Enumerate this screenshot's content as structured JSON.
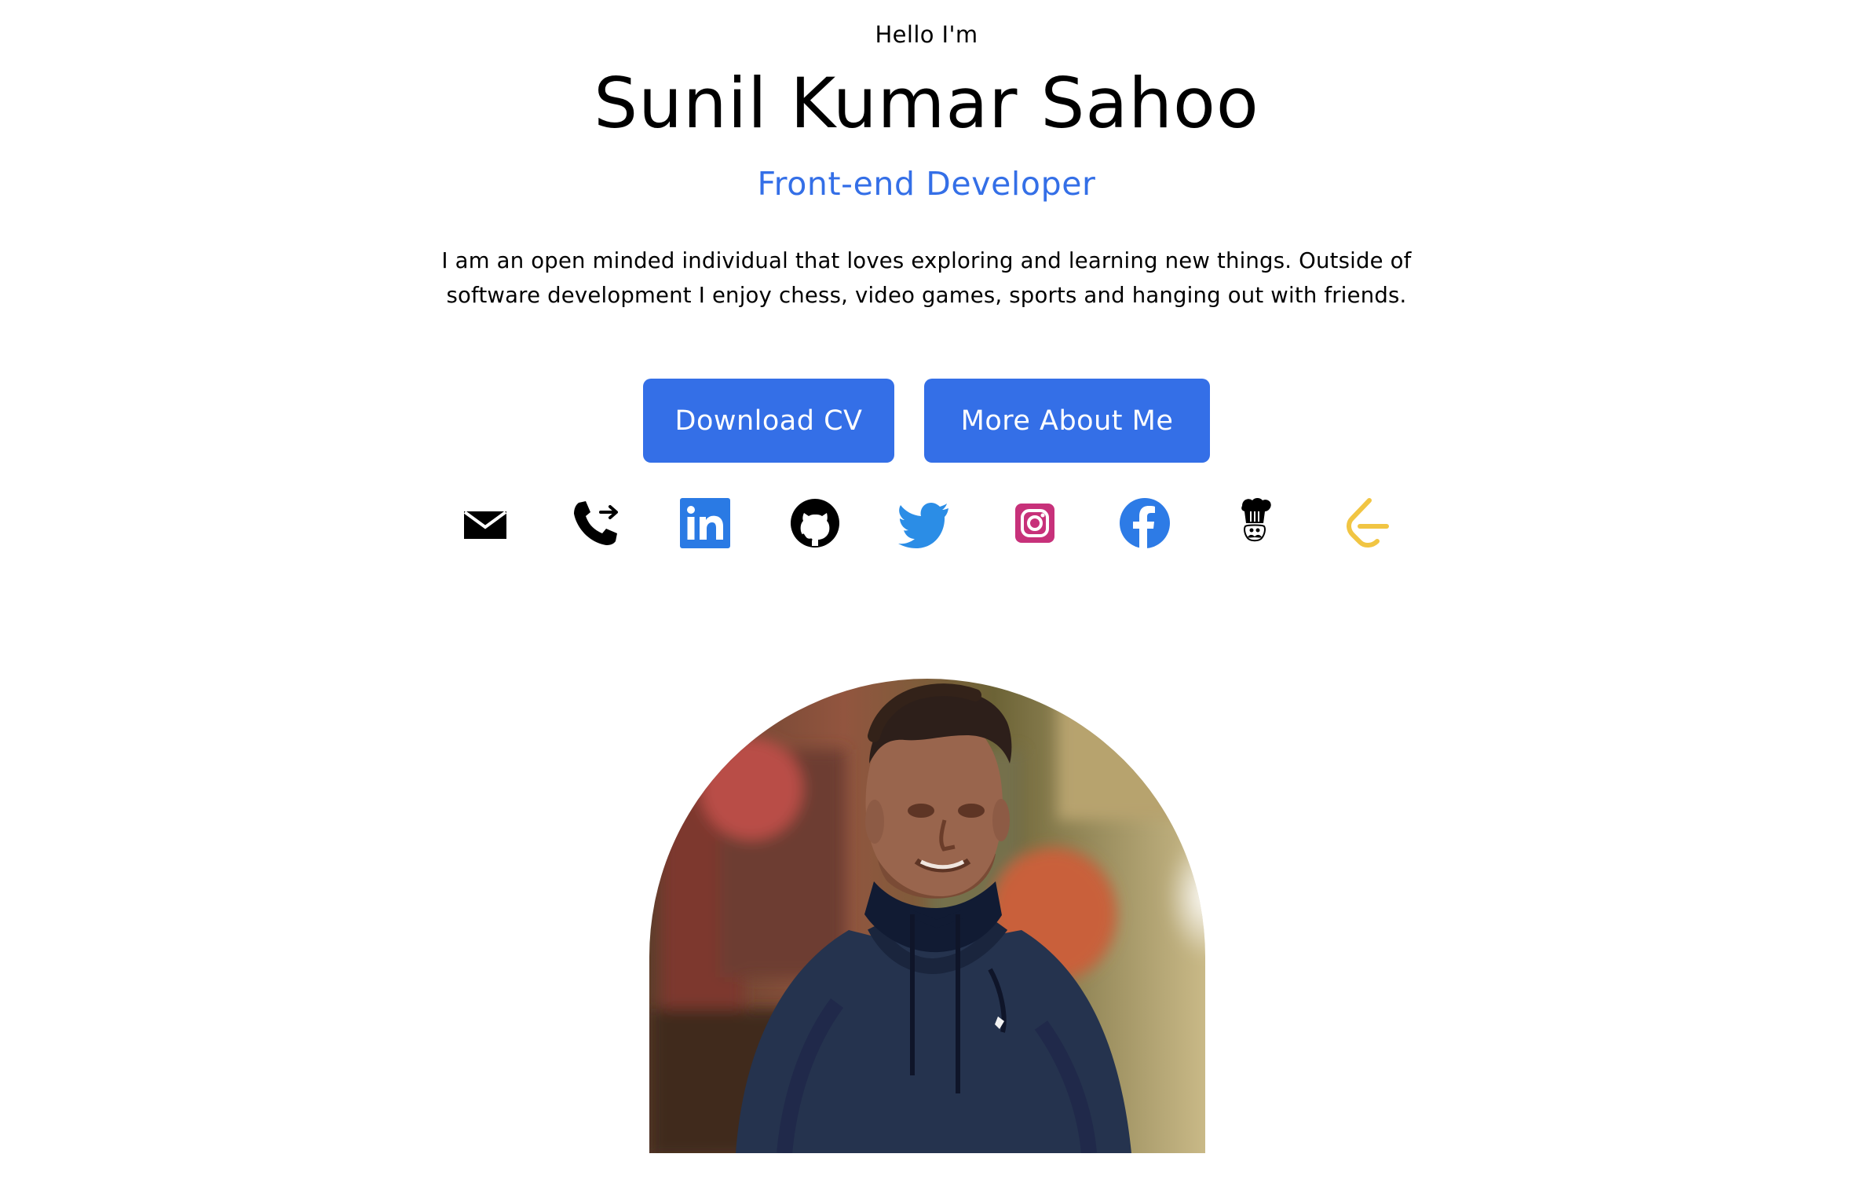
{
  "profile": {
    "greeting": "Hello I'm",
    "name": "Sunil Kumar Sahoo",
    "role": "Front-end Developer",
    "bio": "I am an open minded individual that loves exploring and learning new things. Outside of software development I enjoy chess, video games, sports and hanging out with friends."
  },
  "actions": {
    "download_cv": "Download CV",
    "more_about": "More About Me"
  },
  "socials": [
    {
      "icon": "mail-icon",
      "color": "#000000"
    },
    {
      "icon": "phone-forward-icon",
      "color": "#000000"
    },
    {
      "icon": "linkedin-icon",
      "color": "#2a7ae4"
    },
    {
      "icon": "github-icon",
      "color": "#000000"
    },
    {
      "icon": "twitter-icon",
      "color": "#2b8de6"
    },
    {
      "icon": "instagram-icon",
      "color": "#c7317a"
    },
    {
      "icon": "facebook-icon",
      "color": "#2d7be6"
    },
    {
      "icon": "chef-icon",
      "color": "#000000"
    },
    {
      "icon": "leetcode-icon",
      "color": "#f1c543"
    }
  ],
  "colors": {
    "accent": "#346fe7",
    "text": "#000000",
    "background": "#ffffff"
  }
}
